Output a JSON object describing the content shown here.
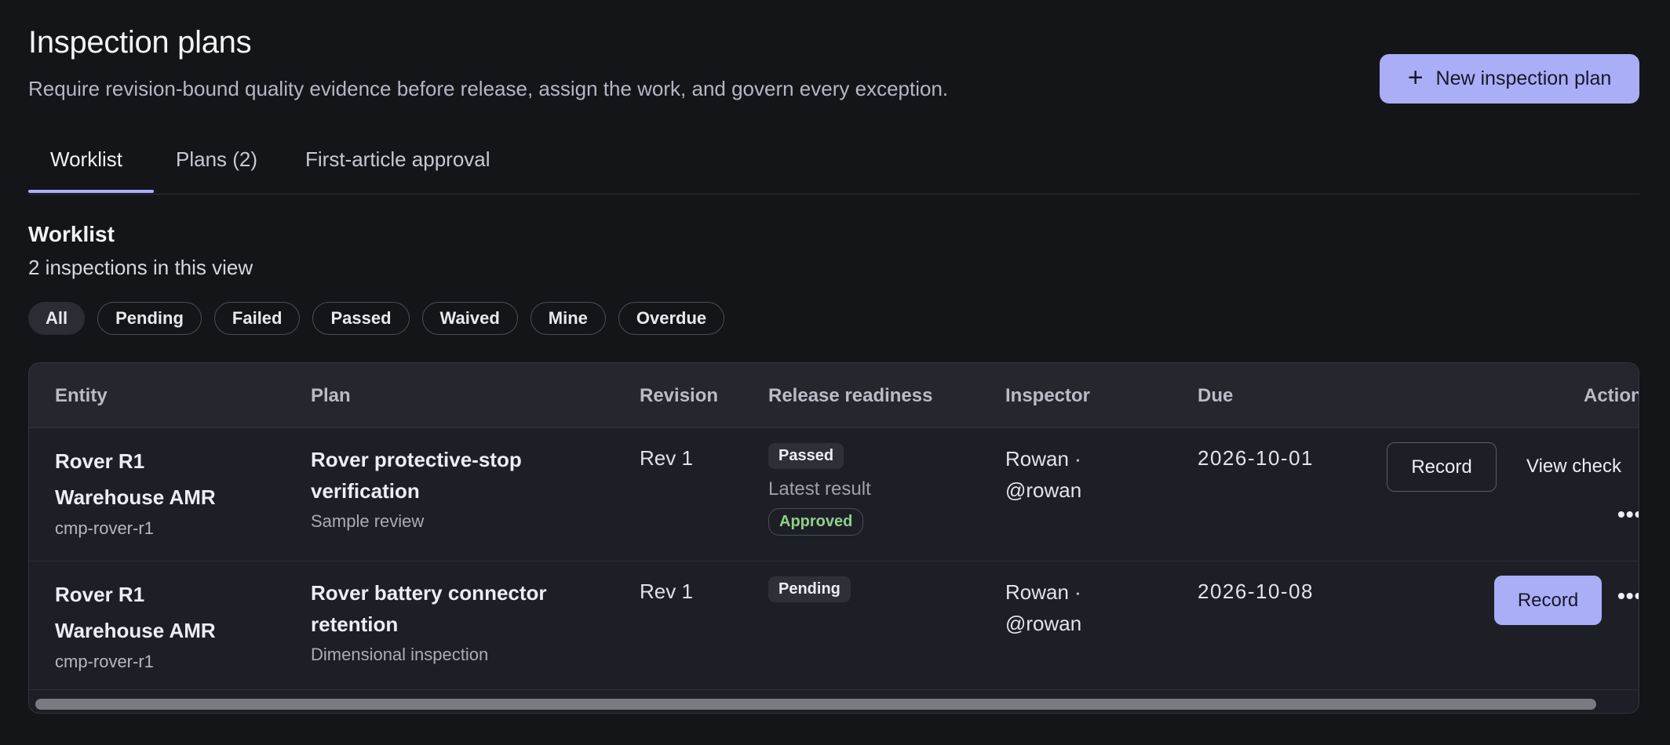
{
  "header": {
    "title": "Inspection plans",
    "subtitle": "Require revision-bound quality evidence before release, assign the work, and govern every exception.",
    "new_button_label": "New inspection plan",
    "new_button_icon": "plus-icon"
  },
  "tabs": [
    {
      "label": "Worklist",
      "active": true
    },
    {
      "label": "Plans (2)",
      "active": false
    },
    {
      "label": "First-article approval",
      "active": false
    }
  ],
  "worklist": {
    "title": "Worklist",
    "count_text": "2 inspections in this view"
  },
  "filters": [
    {
      "label": "All",
      "active": true
    },
    {
      "label": "Pending",
      "active": false
    },
    {
      "label": "Failed",
      "active": false
    },
    {
      "label": "Passed",
      "active": false
    },
    {
      "label": "Waived",
      "active": false
    },
    {
      "label": "Mine",
      "active": false
    },
    {
      "label": "Overdue",
      "active": false
    }
  ],
  "table": {
    "columns": [
      "Entity",
      "Plan",
      "Revision",
      "Release readiness",
      "Inspector",
      "Due",
      "Actions"
    ],
    "rows": [
      {
        "entity_name": "Rover R1 Warehouse AMR",
        "entity_id": "cmp-rover-r1",
        "plan_name": "Rover protective-stop verification",
        "plan_type": "Sample review",
        "revision": "Rev 1",
        "status": "Passed",
        "latest_label": "Latest result",
        "latest_status": "Approved",
        "inspector": "Rowan · @rowan",
        "due": "2026-10-01",
        "action_primary": "Record",
        "action_secondary": "View check",
        "more": "•••"
      },
      {
        "entity_name": "Rover R1 Warehouse AMR",
        "entity_id": "cmp-rover-r1",
        "plan_name": "Rover battery connector retention",
        "plan_type": "Dimensional inspection",
        "revision": "Rev 1",
        "status": "Pending",
        "inspector": "Rowan · @rowan",
        "due": "2026-10-08",
        "action_primary": "Record",
        "more": "•••"
      }
    ]
  },
  "colors": {
    "background": "#141519",
    "accent": "#a9aef7",
    "approved_text": "#8fd08a"
  }
}
